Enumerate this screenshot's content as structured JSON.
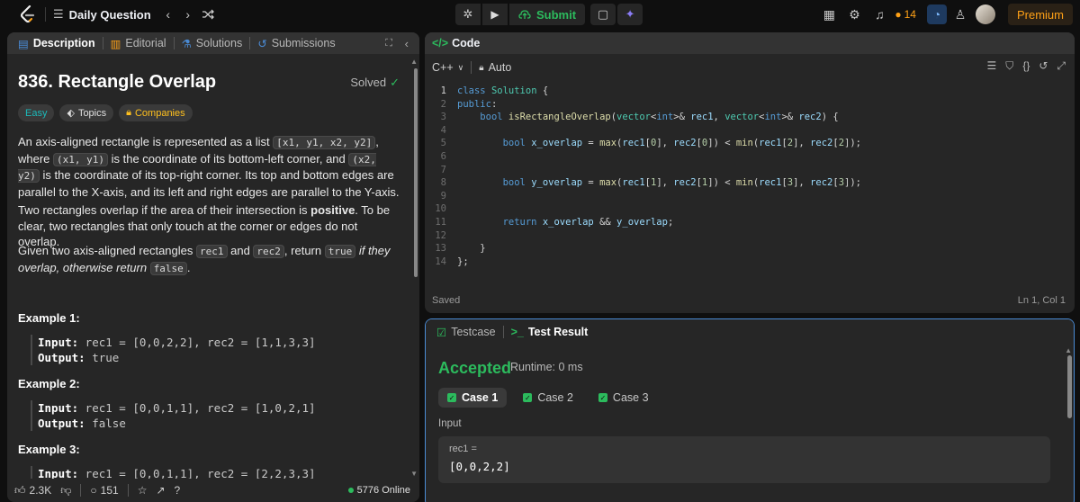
{
  "topbar": {
    "title": "Daily Question",
    "submit": "Submit",
    "streak": "14",
    "premium": "Premium"
  },
  "tabs": {
    "description": "Description",
    "editorial": "Editorial",
    "solutions": "Solutions",
    "submissions": "Submissions"
  },
  "problem": {
    "title": "836. Rectangle Overlap",
    "status": "Solved",
    "difficulty": "Easy",
    "topics": "Topics",
    "companies": "Companies",
    "p1_a": "An axis-aligned rectangle is represented as a list ",
    "p1_code1": "[x1, y1, x2, y2]",
    "p1_b": ", where ",
    "p1_code2": "(x1, y1)",
    "p1_c": " is the coordinate of its bottom-left corner, and ",
    "p1_code3": "(x2, y2)",
    "p1_d": " is the coordinate of its top-right corner. Its top and bottom edges are parallel to the X-axis, and its left and right edges are parallel to the Y-axis.",
    "p2_a": "Two rectangles overlap if the area of their intersection is ",
    "p2_bold": "positive",
    "p2_b": ". To be clear, two rectangles that only touch at the corner or edges do not overlap.",
    "p3_a": "Given two axis-aligned rectangles ",
    "p3_code1": "rec1",
    "p3_b": " and ",
    "p3_code2": "rec2",
    "p3_c": ", return ",
    "p3_code3": "true",
    "p3_it": " if they overlap, otherwise return ",
    "p3_code4": "false",
    "p3_end": ".",
    "examples": [
      {
        "title": "Example 1:",
        "input_label": "Input:",
        "input": " rec1 = [0,0,2,2], rec2 = [1,1,3,3]",
        "output_label": "Output:",
        "output": " true"
      },
      {
        "title": "Example 2:",
        "input_label": "Input:",
        "input": " rec1 = [0,0,1,1], rec2 = [1,0,2,1]",
        "output_label": "Output:",
        "output": " false"
      },
      {
        "title": "Example 3:",
        "input_label": "Input:",
        "input": " rec1 = [0,0,1,1], rec2 = [2,2,3,3]"
      }
    ]
  },
  "footer": {
    "likes": "2.3K",
    "comments": "151",
    "online": "5776 Online"
  },
  "code": {
    "header": "Code",
    "language": "C++",
    "mode": "Auto",
    "status": "Saved",
    "position": "Ln 1, Col 1",
    "lines": [
      "1",
      "2",
      "3",
      "4",
      "5",
      "6",
      "7",
      "8",
      "9",
      "10",
      "11",
      "12",
      "13",
      "14"
    ]
  },
  "result": {
    "tab_testcase": "Testcase",
    "tab_result": "Test Result",
    "verdict": "Accepted",
    "runtime": "Runtime: 0 ms",
    "cases": [
      "Case 1",
      "Case 2",
      "Case 3"
    ],
    "input_label": "Input",
    "input_name": "rec1 =",
    "input_value": "[0,0,2,2]"
  },
  "colors": {
    "accent_green": "#2cbb5d",
    "premium_orange": "#ffa116",
    "easy_teal": "#1cbaba",
    "panel_bg": "#262626",
    "focus_border": "#4a8bd5"
  }
}
